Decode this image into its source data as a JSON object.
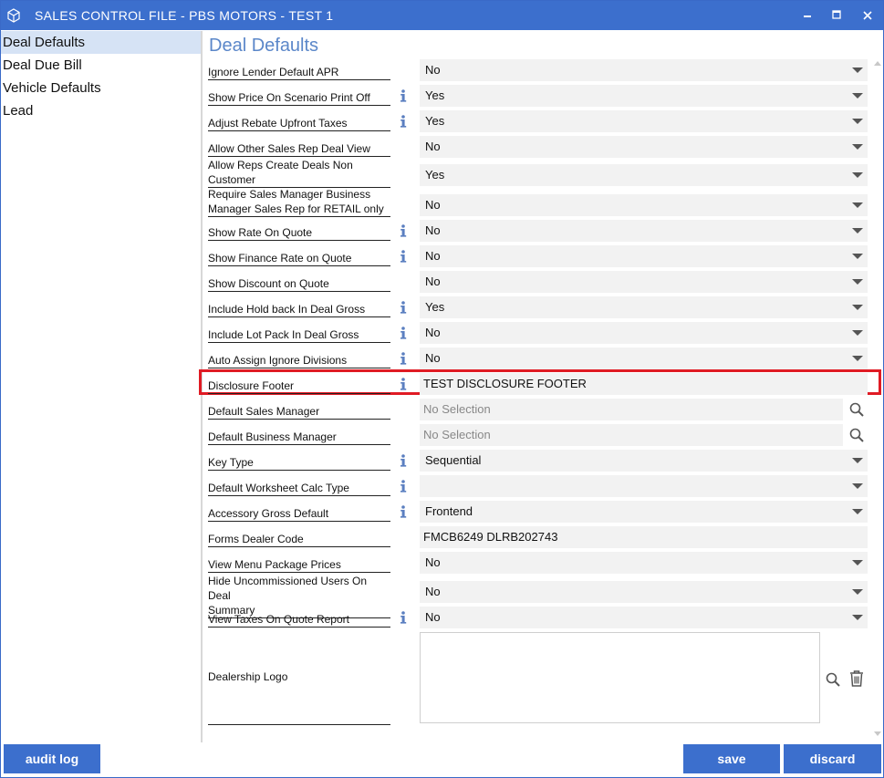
{
  "window": {
    "title": "SALES CONTROL FILE - PBS MOTORS - TEST 1"
  },
  "sidebar": {
    "items": [
      {
        "label": "Deal Defaults",
        "active": true
      },
      {
        "label": "Deal Due Bill",
        "active": false
      },
      {
        "label": "Vehicle Defaults",
        "active": false
      },
      {
        "label": "Lead",
        "active": false
      }
    ]
  },
  "main": {
    "title": "Deal Defaults",
    "fields": [
      {
        "label": [
          "Ignore Lender Default APR"
        ],
        "value": "No",
        "type": "select",
        "info": false
      },
      {
        "label": [
          "Show Price On Scenario Print Off"
        ],
        "value": "Yes",
        "type": "select",
        "info": true
      },
      {
        "label": [
          "Adjust Rebate Upfront Taxes"
        ],
        "value": "Yes",
        "type": "select",
        "info": true
      },
      {
        "label": [
          "Allow Other Sales Rep Deal View"
        ],
        "value": "No",
        "type": "select",
        "info": false
      },
      {
        "label": [
          "Allow Reps Create Deals Non",
          "Customer"
        ],
        "value": "Yes",
        "type": "select",
        "info": false
      },
      {
        "label": [
          "Require Sales Manager Business",
          "Manager Sales Rep for RETAIL only"
        ],
        "value": "No",
        "type": "select",
        "info": false
      },
      {
        "label": [
          "Show Rate On Quote"
        ],
        "value": "No",
        "type": "select",
        "info": true
      },
      {
        "label": [
          "Show Finance Rate on Quote"
        ],
        "value": "No",
        "type": "select",
        "info": true
      },
      {
        "label": [
          "Show Discount on Quote"
        ],
        "value": "No",
        "type": "select",
        "info": false
      },
      {
        "label": [
          "Include Hold back In Deal Gross"
        ],
        "value": "Yes",
        "type": "select",
        "info": true
      },
      {
        "label": [
          "Include Lot Pack In Deal Gross"
        ],
        "value": "No",
        "type": "select",
        "info": true
      },
      {
        "label": [
          "Auto Assign Ignore Divisions"
        ],
        "value": "No",
        "type": "select",
        "info": true
      },
      {
        "label": [
          "Disclosure Footer"
        ],
        "value": "TEST DISCLOSURE FOOTER",
        "type": "text",
        "info": true
      },
      {
        "label": [
          "Default Sales Manager"
        ],
        "value": "No Selection",
        "type": "lookup",
        "info": false
      },
      {
        "label": [
          "Default Business Manager"
        ],
        "value": "No Selection",
        "type": "lookup",
        "info": false
      },
      {
        "label": [
          "Key Type"
        ],
        "value": "Sequential",
        "type": "select",
        "info": true
      },
      {
        "label": [
          "Default Worksheet Calc Type"
        ],
        "value": "",
        "type": "select",
        "info": true
      },
      {
        "label": [
          "Accessory Gross Default"
        ],
        "value": "Frontend",
        "type": "select",
        "info": true
      },
      {
        "label": [
          "Forms Dealer Code"
        ],
        "value": "FMCB6249 DLRB202743",
        "type": "text",
        "info": false
      },
      {
        "label": [
          "View Menu Package Prices"
        ],
        "value": "No",
        "type": "select",
        "info": false
      },
      {
        "label": [
          "Hide Uncommissioned Users On Deal",
          "Summary"
        ],
        "value": "No",
        "type": "select",
        "info": false
      },
      {
        "label": [
          "View Taxes On Quote Report"
        ],
        "value": "No",
        "type": "select",
        "info": true
      },
      {
        "label": [
          "Dealership Logo"
        ],
        "value": "",
        "type": "image",
        "info": false
      }
    ]
  },
  "footer": {
    "audit_label": "audit log",
    "save_label": "save",
    "discard_label": "discard"
  },
  "colors": {
    "accent": "#3c6fcd",
    "title_text": "#5b87c9",
    "sidebar_active": "#d6e3f5",
    "highlight": "#e01b24",
    "info_icon": "#5b7fc0"
  },
  "icons": {
    "app": "cube-icon",
    "info": "info-icon",
    "lookup": "search-icon",
    "delete": "trash-icon",
    "dropdown": "chevron-down-icon"
  }
}
